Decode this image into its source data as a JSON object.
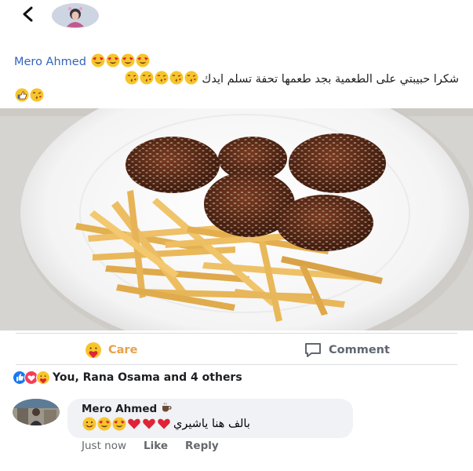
{
  "header": {
    "back_icon": "chevron-left-icon",
    "avatar": "profile-avatar"
  },
  "post": {
    "author": "Mero Ahmed",
    "author_emojis": [
      "heart-eyes",
      "heart-eyes",
      "heart-eyes",
      "heart-eyes"
    ],
    "text": "شكرا حبيبتي على الطعمية بجد طعمها تحفة تسلم ايدك",
    "text_emojis": [
      "kiss-face",
      "kiss-face",
      "kiss-face",
      "kiss-face",
      "kiss-face"
    ],
    "line2_emojis": [
      "thumbs-up",
      "kiss-face"
    ],
    "photo": "plate of falafel with sesame and french fries"
  },
  "actions": {
    "care_label": "Care",
    "comment_label": "Comment"
  },
  "reactions": {
    "summary": "You, Rana Osama and 4 others",
    "icons": [
      "like",
      "love",
      "care"
    ]
  },
  "comment": {
    "author": "Mero Ahmed",
    "author_emoji": "coffee",
    "text": "بالف هنا ياشيري",
    "emojis": [
      "smile",
      "heart-eyes",
      "heart-eyes",
      "heart",
      "heart",
      "heart"
    ],
    "time": "Just now",
    "like_label": "Like",
    "reply_label": "Reply"
  },
  "colors": {
    "author_blue": "#3563b9",
    "care_orange": "#e8a14a",
    "meta_gray": "#65676b",
    "bubble_bg": "#f0f2f5"
  }
}
